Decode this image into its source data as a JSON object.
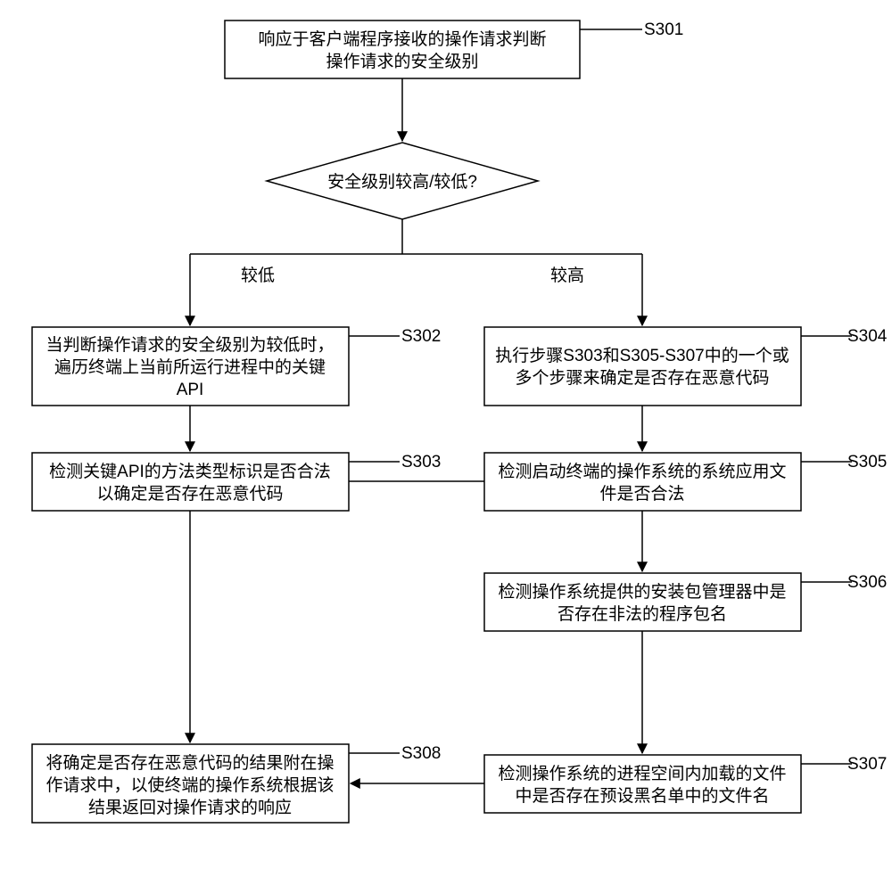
{
  "chart_data": {
    "type": "flowchart",
    "nodes": [
      {
        "id": "S301",
        "text": "响应于客户端程序接收的操作请求判断操作请求的安全级别"
      },
      {
        "id": "decision",
        "text": "安全级别较高/较低?"
      },
      {
        "id": "S302",
        "text": "当判断操作请求的安全级别为较低时，遍历终端上当前所运行进程中的关键API"
      },
      {
        "id": "S303",
        "text": "检测关键API的方法类型标识是否合法以确定是否存在恶意代码"
      },
      {
        "id": "S304",
        "text": "执行步骤S303和S305-S307中的一个或多个步骤来确定是否存在恶意代码"
      },
      {
        "id": "S305",
        "text": "检测启动终端的操作系统的系统应用文件是否合法"
      },
      {
        "id": "S306",
        "text": "检测操作系统提供的安装包管理器中是否存在非法的程序包名"
      },
      {
        "id": "S307",
        "text": "检测操作系统的进程空间内加载的文件中是否存在预设黑名单中的文件名"
      },
      {
        "id": "S308",
        "text": "将确定是否存在恶意代码的结果附在操作请求中，以使终端的操作系统根据该结果返回对操作请求的响应"
      }
    ],
    "edges": [
      {
        "from": "S301",
        "to": "decision"
      },
      {
        "from": "decision",
        "to": "S302",
        "label": "较低"
      },
      {
        "from": "decision",
        "to": "S304",
        "label": "较高"
      },
      {
        "from": "S302",
        "to": "S303"
      },
      {
        "from": "S304",
        "to": "S305"
      },
      {
        "from": "S305",
        "to": "S306"
      },
      {
        "from": "S306",
        "to": "S307"
      },
      {
        "from": "S303",
        "to": "S308"
      },
      {
        "from": "S307",
        "to": "S308"
      },
      {
        "from": "S305",
        "to": "S303"
      }
    ]
  },
  "steps": {
    "s301_l1": "响应于客户端程序接收的操作请求判断",
    "s301_l2": "操作请求的安全级别",
    "s301_tag": "S301",
    "decision": "安全级别较高/较低?",
    "branch_low": "较低",
    "branch_high": "较高",
    "s302_l1": "当判断操作请求的安全级别为较低时，",
    "s302_l2": "遍历终端上当前所运行进程中的关键",
    "s302_l3": "API",
    "s302_tag": "S302",
    "s303_l1": "检测关键API的方法类型标识是否合法",
    "s303_l2": "以确定是否存在恶意代码",
    "s303_tag": "S303",
    "s304_l1": "执行步骤S303和S305-S307中的一个或",
    "s304_l2": "多个步骤来确定是否存在恶意代码",
    "s304_tag": "S304",
    "s305_l1": "检测启动终端的操作系统的系统应用文",
    "s305_l2": "件是否合法",
    "s305_tag": "S305",
    "s306_l1": "检测操作系统提供的安装包管理器中是",
    "s306_l2": "否存在非法的程序包名",
    "s306_tag": "S306",
    "s307_l1": "检测操作系统的进程空间内加载的文件",
    "s307_l2": "中是否存在预设黑名单中的文件名",
    "s307_tag": "S307",
    "s308_l1": "将确定是否存在恶意代码的结果附在操",
    "s308_l2": "作请求中，以使终端的操作系统根据该",
    "s308_l3": "结果返回对操作请求的响应",
    "s308_tag": "S308"
  }
}
